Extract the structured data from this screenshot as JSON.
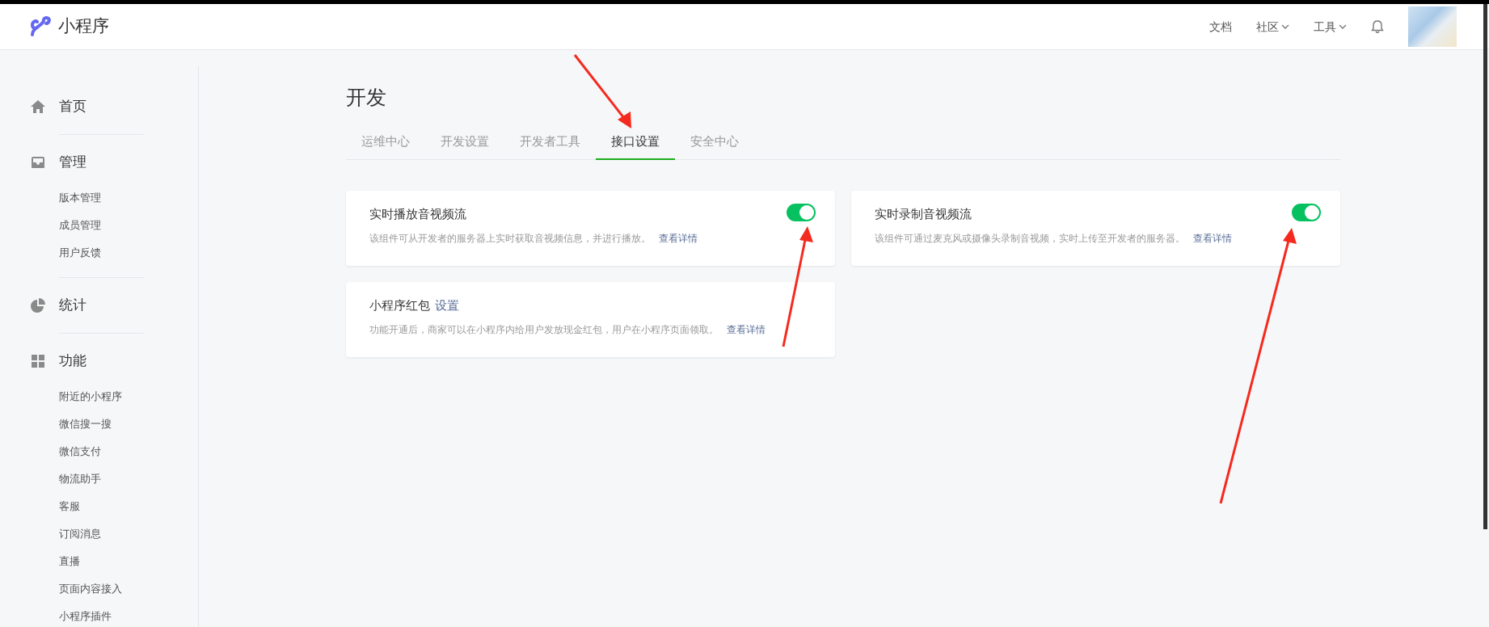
{
  "header": {
    "logo_text": "小程序",
    "nav": [
      {
        "label": "文档",
        "dropdown": false
      },
      {
        "label": "社区",
        "dropdown": true
      },
      {
        "label": "工具",
        "dropdown": true
      }
    ]
  },
  "sidebar": {
    "sections": [
      {
        "label": "首页"
      },
      {
        "label": "管理",
        "children": [
          {
            "label": "版本管理"
          },
          {
            "label": "成员管理"
          },
          {
            "label": "用户反馈"
          }
        ]
      },
      {
        "label": "统计"
      },
      {
        "label": "功能",
        "children": [
          {
            "label": "附近的小程序"
          },
          {
            "label": "微信搜一搜"
          },
          {
            "label": "微信支付"
          },
          {
            "label": "物流助手"
          },
          {
            "label": "客服"
          },
          {
            "label": "订阅消息"
          },
          {
            "label": "直播"
          },
          {
            "label": "页面内容接入"
          },
          {
            "label": "小程序插件"
          }
        ]
      }
    ]
  },
  "page_title": "开发",
  "tabs": [
    {
      "label": "运维中心",
      "selected": false
    },
    {
      "label": "开发设置",
      "selected": false
    },
    {
      "label": "开发者工具",
      "selected": false
    },
    {
      "label": "接口设置",
      "selected": true
    },
    {
      "label": "安全中心",
      "selected": false
    }
  ],
  "cards": [
    {
      "kind": "toggle",
      "title": "实时播放音视频流",
      "on": true,
      "description": "该组件可从开发者的服务器上实时获取音视频信息，并进行播放。",
      "link": "查看详情"
    },
    {
      "kind": "toggle",
      "title": "实时录制音视频流",
      "on": true,
      "description": "该组件可通过麦克风或摄像头录制音视频，实时上传至开发者的服务器。",
      "link": "查看详情"
    },
    {
      "kind": "setting",
      "title": "小程序红包",
      "title_link": "设置",
      "description": "功能开通后，商家可以在小程序内给用户发放现金红包，用户在小程序页面领取。",
      "link": "查看详情"
    }
  ]
}
